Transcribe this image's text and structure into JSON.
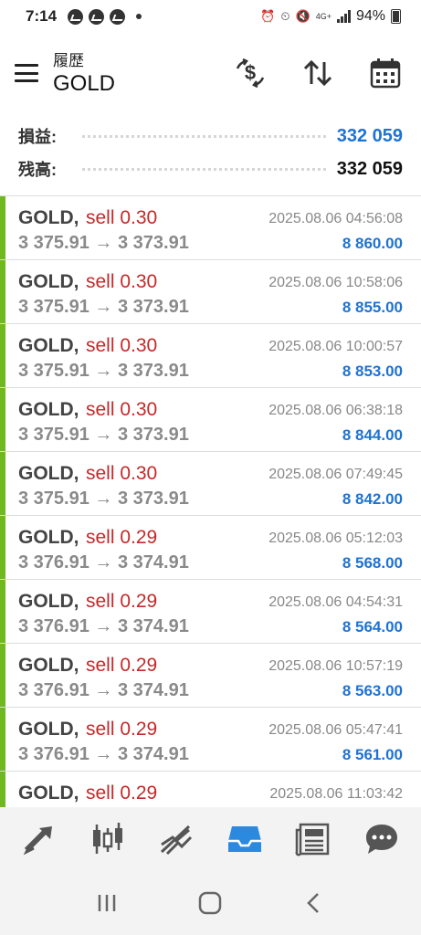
{
  "status_bar": {
    "time": "7:14",
    "network": "4G+",
    "battery": "94%"
  },
  "header": {
    "subtitle": "履歴",
    "title": "GOLD"
  },
  "summary": {
    "profit_label": "損益:",
    "profit_value": "332 059",
    "balance_label": "残高:",
    "balance_value": "332 059"
  },
  "colors": {
    "accent_blue": "#1e73d2",
    "sell_red": "#c62828",
    "row_bar_green": "#6fb820"
  },
  "trades": [
    {
      "symbol": "GOLD,",
      "side": "sell 0.30",
      "time": "2025.08.06 04:56:08",
      "prices": "3 375.91 → 3 373.91",
      "profit": "8 860.00"
    },
    {
      "symbol": "GOLD,",
      "side": "sell 0.30",
      "time": "2025.08.06 10:58:06",
      "prices": "3 375.91 → 3 373.91",
      "profit": "8 855.00"
    },
    {
      "symbol": "GOLD,",
      "side": "sell 0.30",
      "time": "2025.08.06 10:00:57",
      "prices": "3 375.91 → 3 373.91",
      "profit": "8 853.00"
    },
    {
      "symbol": "GOLD,",
      "side": "sell 0.30",
      "time": "2025.08.06 06:38:18",
      "prices": "3 375.91 → 3 373.91",
      "profit": "8 844.00"
    },
    {
      "symbol": "GOLD,",
      "side": "sell 0.30",
      "time": "2025.08.06 07:49:45",
      "prices": "3 375.91 → 3 373.91",
      "profit": "8 842.00"
    },
    {
      "symbol": "GOLD,",
      "side": "sell 0.29",
      "time": "2025.08.06 05:12:03",
      "prices": "3 376.91 → 3 374.91",
      "profit": "8 568.00"
    },
    {
      "symbol": "GOLD,",
      "side": "sell 0.29",
      "time": "2025.08.06 04:54:31",
      "prices": "3 376.91 → 3 374.91",
      "profit": "8 564.00"
    },
    {
      "symbol": "GOLD,",
      "side": "sell 0.29",
      "time": "2025.08.06 10:57:19",
      "prices": "3 376.91 → 3 374.91",
      "profit": "8 563.00"
    },
    {
      "symbol": "GOLD,",
      "side": "sell 0.29",
      "time": "2025.08.06 05:47:41",
      "prices": "3 376.91 → 3 374.91",
      "profit": "8 561.00"
    },
    {
      "symbol": "GOLD,",
      "side": "sell 0.29",
      "time": "2025.08.06 11:03:42",
      "prices": "",
      "profit": ""
    }
  ],
  "header_icons": [
    "currency-exchange-icon",
    "sort-icon",
    "calendar-icon"
  ],
  "bottom_tabs": [
    {
      "icon": "trade-arrows-icon",
      "active": false
    },
    {
      "icon": "candlestick-chart-icon",
      "active": false
    },
    {
      "icon": "line-chart-icon",
      "active": false
    },
    {
      "icon": "history-inbox-icon",
      "active": true
    },
    {
      "icon": "news-icon",
      "active": false
    },
    {
      "icon": "chat-bubble-icon",
      "active": false
    }
  ],
  "system_nav": [
    "recent-apps-icon",
    "home-icon",
    "back-icon"
  ]
}
